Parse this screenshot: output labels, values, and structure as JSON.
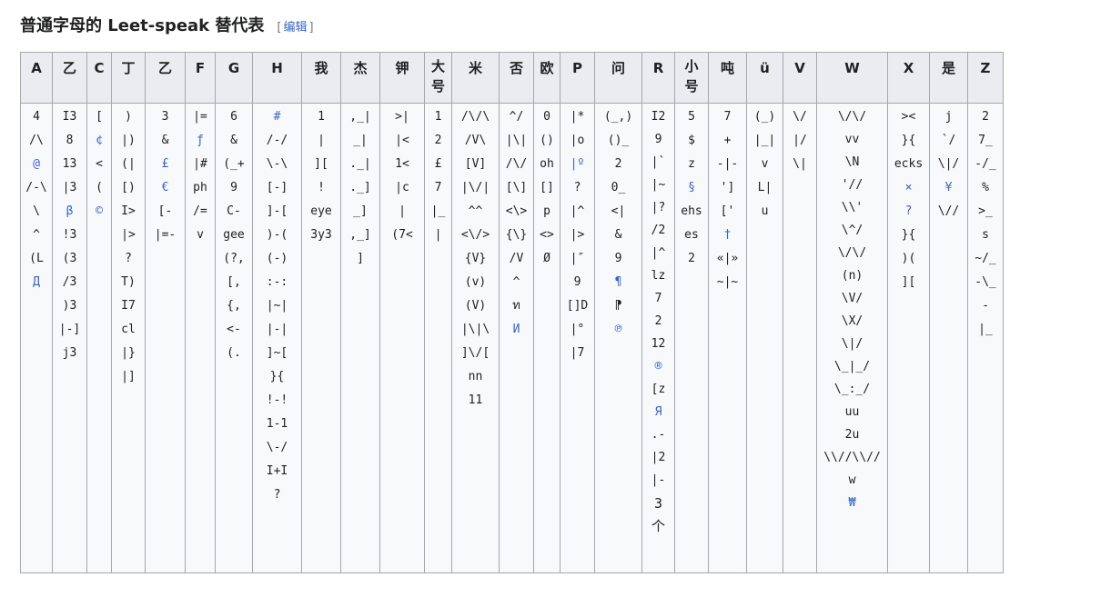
{
  "heading": {
    "title": "普通字母的 Leet-speak 替代表",
    "bracket_open": "[",
    "edit": "编辑",
    "bracket_close": "]"
  },
  "colors": {
    "link": "#3366cc",
    "header_bg": "#eaecf0",
    "border": "#a2a9b1",
    "cell_bg": "#f8f9fa"
  },
  "columns": [
    {
      "header": "A",
      "values": [
        "4",
        "/\\",
        "@",
        "/-\\",
        "\\",
        "^",
        "(L",
        "Д"
      ],
      "links": [
        2,
        7
      ]
    },
    {
      "header": "乙",
      "values": [
        "I3",
        "8",
        "13",
        "|3",
        "β",
        "!3",
        "(3",
        "/3",
        ")3",
        "|-]",
        "j3"
      ],
      "links": [
        4
      ]
    },
    {
      "header": "C",
      "values": [
        "[",
        "¢",
        "<",
        "(",
        "©"
      ],
      "links": [
        1,
        4
      ]
    },
    {
      "header": "丁",
      "values": [
        ")",
        "|)",
        "(|",
        "[)",
        "I>",
        "|>",
        "?",
        "T)",
        "I7",
        "cl",
        "|}",
        "|]"
      ],
      "links": []
    },
    {
      "header": "乙",
      "values": [
        "3",
        "&",
        "£",
        "€",
        "[-",
        "|=-"
      ],
      "links": [
        2,
        3
      ]
    },
    {
      "header": "F",
      "values": [
        "|=",
        "ƒ",
        "|#",
        "ph",
        "/=",
        "v"
      ],
      "links": [
        1
      ]
    },
    {
      "header": "G",
      "values": [
        "6",
        "&",
        "(_+",
        "9",
        "C-",
        "gee",
        "(?,",
        "[,",
        "{,",
        "<-",
        "(."
      ],
      "links": []
    },
    {
      "header": "H",
      "values": [
        "#",
        "/-/",
        "\\-\\",
        "[-]",
        "]-[",
        ")-(",
        "(-)",
        ":-:",
        "|~|",
        "|-|",
        "]~[",
        "}{",
        "!-!",
        "1-1",
        "\\-/",
        "I+I",
        "?"
      ],
      "links": [
        0
      ]
    },
    {
      "header": "我",
      "values": [
        "1",
        "|",
        "][",
        "!",
        "eye",
        "3y3"
      ],
      "links": []
    },
    {
      "header": "杰",
      "values": [
        ",_|",
        "_|",
        "._|",
        "._]",
        "_]",
        ",_]",
        "]"
      ],
      "links": []
    },
    {
      "header": "钾",
      "values": [
        ">|",
        "|<",
        "1<",
        "|c",
        "|",
        "(7<"
      ],
      "links": []
    },
    {
      "header": "大号",
      "values": [
        "1",
        "2",
        "£",
        "7",
        "|_",
        "|"
      ],
      "links": []
    },
    {
      "header": "米",
      "values": [
        "/\\/\\",
        "/V\\",
        "[V]",
        "|\\/|",
        "^^",
        "<\\/>",
        "{V}",
        "(v)",
        "(V)",
        "|\\|\\",
        "]\\/[",
        "nn",
        "11"
      ],
      "links": []
    },
    {
      "header": "否",
      "values": [
        "^/",
        "|\\|",
        "/\\/",
        "[\\]",
        "<\\>",
        "{\\}",
        "/V",
        "^",
        "ท",
        "И"
      ],
      "links": [
        9
      ]
    },
    {
      "header": "欧",
      "values": [
        "0",
        "()",
        "oh",
        "[]",
        "p",
        "<>",
        "Ø"
      ],
      "links": []
    },
    {
      "header": "P",
      "values": [
        "|*",
        "|o",
        "|º",
        "?",
        "|^",
        "|>",
        "|″",
        "9",
        "[]D",
        "|°",
        "|7"
      ],
      "links": [
        2
      ]
    },
    {
      "header": "问",
      "values": [
        "(_,)",
        "()_",
        "2",
        "0_",
        "<|",
        "&",
        "9",
        "¶",
        "⁋",
        "℗"
      ],
      "links": [
        7,
        9
      ]
    },
    {
      "header": "R",
      "values": [
        "I2",
        "9",
        "|`",
        "|~",
        "|?",
        "/2",
        "|^",
        "lz",
        "7",
        "2",
        "12",
        "®",
        "[z",
        "Я",
        ".-",
        "|2",
        "|-",
        "3",
        "个"
      ],
      "links": [
        11,
        13
      ]
    },
    {
      "header": "小号",
      "values": [
        "5",
        "$",
        "z",
        "§",
        "ehs",
        "es",
        "2"
      ],
      "links": [
        3
      ]
    },
    {
      "header": "吨",
      "values": [
        "7",
        "+",
        "-|-",
        "']",
        "['",
        "†",
        "«|»",
        "~|~"
      ],
      "links": [
        5
      ]
    },
    {
      "header": "ü",
      "values": [
        "(_)",
        "|_|",
        "v",
        "L|",
        "u"
      ],
      "links": []
    },
    {
      "header": "V",
      "values": [
        "\\/",
        "|/",
        "\\|"
      ],
      "links": []
    },
    {
      "header": "W",
      "values": [
        "\\/\\/",
        "vv",
        "\\N",
        "'//",
        "\\\\'",
        "\\^/",
        "\\/\\/",
        "(n)",
        "\\V/",
        "\\X/",
        "\\|/",
        "\\_|_/",
        "\\_:_/",
        "uu",
        "2u",
        "\\\\//\\\\//",
        "w",
        "₩"
      ],
      "links": [
        17
      ]
    },
    {
      "header": "X",
      "values": [
        "><",
        "}{",
        "ecks",
        "×",
        "?",
        "}{",
        ")(",
        "]["
      ],
      "links": [
        3,
        4
      ]
    },
    {
      "header": "是",
      "values": [
        "j",
        "`/",
        "\\|/",
        "¥",
        "\\//"
      ],
      "links": [
        3
      ]
    },
    {
      "header": "Z",
      "values": [
        "2",
        "7_",
        "-/_",
        "%",
        ">_",
        "s",
        "~/_",
        "-\\_",
        "-",
        "|_"
      ],
      "links": []
    }
  ]
}
